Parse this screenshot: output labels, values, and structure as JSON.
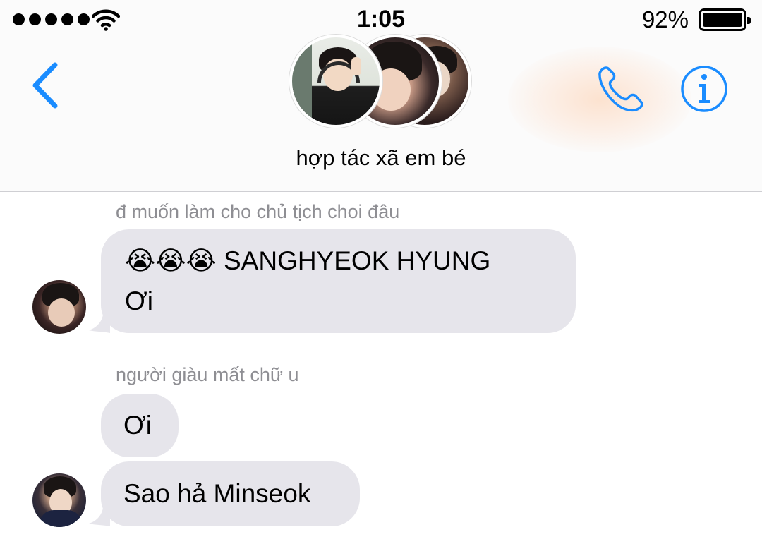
{
  "status_bar": {
    "time": "1:05",
    "battery_percent": "92%",
    "signal_bars": 5
  },
  "header": {
    "back_icon": "chevron-left-icon",
    "group_name": "hợp tác xã em bé",
    "call_icon": "phone-icon",
    "info_icon": "info-icon",
    "accent_color": "#1a8cff"
  },
  "messages": [
    {
      "sender": "đ muốn làm cho chủ tịch choi đâu",
      "line1": "😭😭😭 SANGHYEOK HYUNG",
      "line2": "Ơi"
    },
    {
      "sender": "người giàu mất chữ u",
      "bubbles": [
        "Ơi",
        "Sao hả Minseok"
      ]
    }
  ]
}
